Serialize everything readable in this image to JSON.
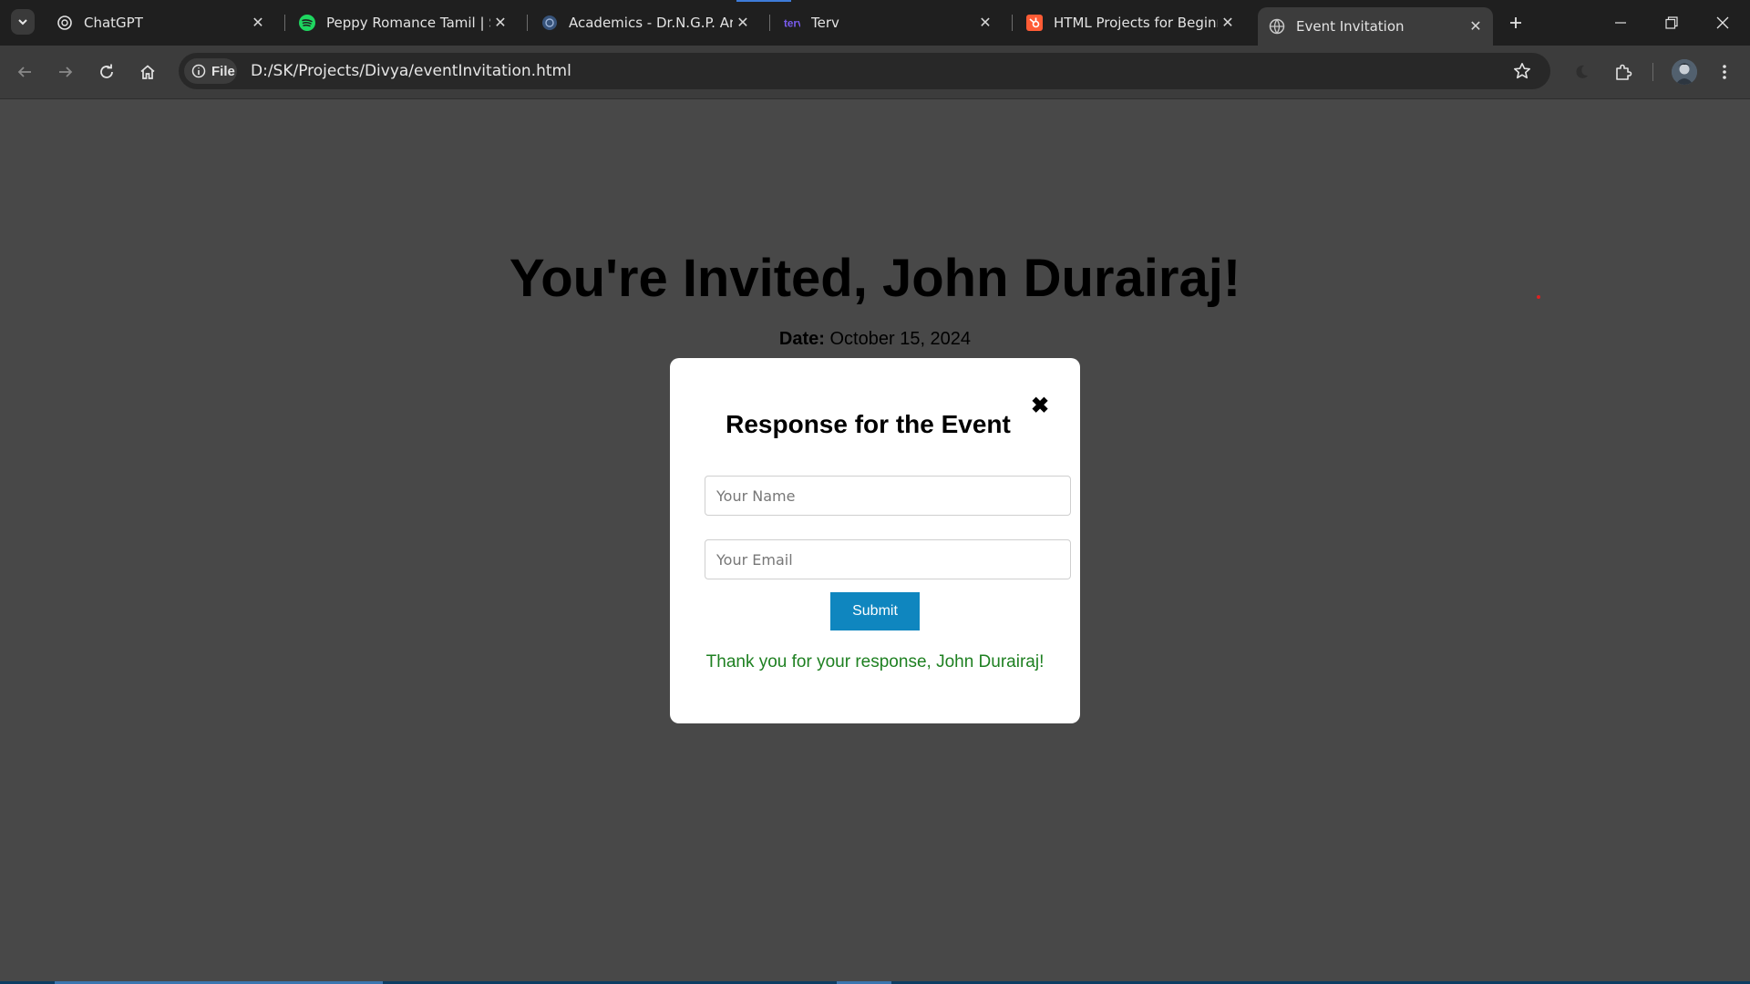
{
  "browser": {
    "tabs": [
      {
        "title": "ChatGPT",
        "icon": "chatgpt-icon",
        "active": false
      },
      {
        "title": "Peppy Romance Tamil | Spotify",
        "icon": "spotify-icon",
        "active": false
      },
      {
        "title": "Academics - Dr.N.G.P. Arts and Science College",
        "icon": "college-icon",
        "active": false
      },
      {
        "title": "Terv",
        "icon": "terv-icon",
        "active": false
      },
      {
        "title": "HTML Projects for Beginners",
        "icon": "hubspot-icon",
        "active": false
      },
      {
        "title": "Event Invitation",
        "icon": "globe-icon",
        "active": true
      }
    ],
    "address_chip": "File",
    "url": "D:/SK/Projects/Divya/eventInvitation.html"
  },
  "page": {
    "heading": "You're Invited, John Durairaj!",
    "date_label": "Date:",
    "date_value": "October 15, 2024"
  },
  "modal": {
    "title": "Response for the Event",
    "close_symbol": "✖",
    "name_placeholder": "Your Name",
    "email_placeholder": "Your Email",
    "submit_label": "Submit",
    "thank_you_message": "Thank you for your response, John Durairaj!"
  },
  "colors": {
    "page_background": "#484848",
    "submit_button": "#0f86bf",
    "thank_you_text": "#1e8021"
  }
}
